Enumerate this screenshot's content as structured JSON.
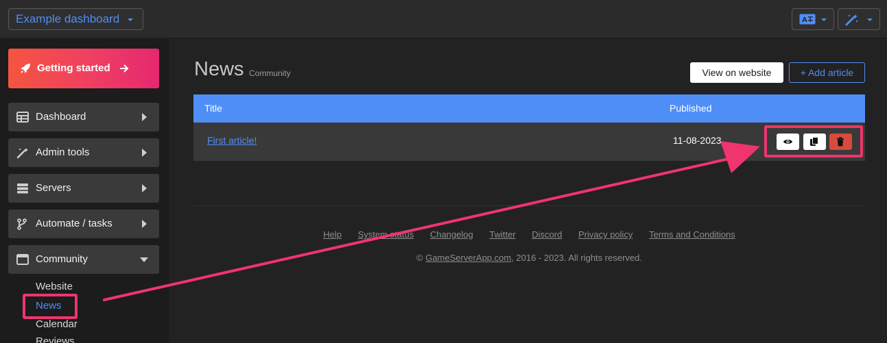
{
  "topbar": {
    "dashboard_select": "Example dashboard",
    "translate_icon": "translate-icon",
    "magic_icon": "magic-wand-icon"
  },
  "sidebar": {
    "getting_started": "Getting started",
    "items": [
      {
        "label": "Dashboard",
        "icon": "table-icon"
      },
      {
        "label": "Admin tools",
        "icon": "magic-wand-icon"
      },
      {
        "label": "Servers",
        "icon": "server-icon"
      },
      {
        "label": "Automate / tasks",
        "icon": "branch-icon"
      },
      {
        "label": "Community",
        "icon": "window-icon"
      }
    ],
    "sub_items": [
      "Website",
      "News",
      "Calendar",
      "Reviews"
    ]
  },
  "main": {
    "title": "News",
    "subtitle": "Community",
    "view_button": "View on website",
    "add_button": "+ Add article",
    "table": {
      "headers": [
        "Title",
        "Published"
      ],
      "rows": [
        {
          "title": "First article!",
          "published": "11-08-2023"
        }
      ]
    }
  },
  "footer": {
    "links": [
      "Help",
      "System status",
      "Changelog",
      "Twitter",
      "Discord",
      "Privacy policy",
      "Terms and Conditions"
    ],
    "copyright_prefix": "© ",
    "copyright_link": "GameServerApp.com",
    "copyright_suffix": ", 2016 - 2023. All rights reserved."
  },
  "colors": {
    "accent": "#4f8ef7",
    "annotation": "#f0346e",
    "danger": "#d84a3c"
  }
}
